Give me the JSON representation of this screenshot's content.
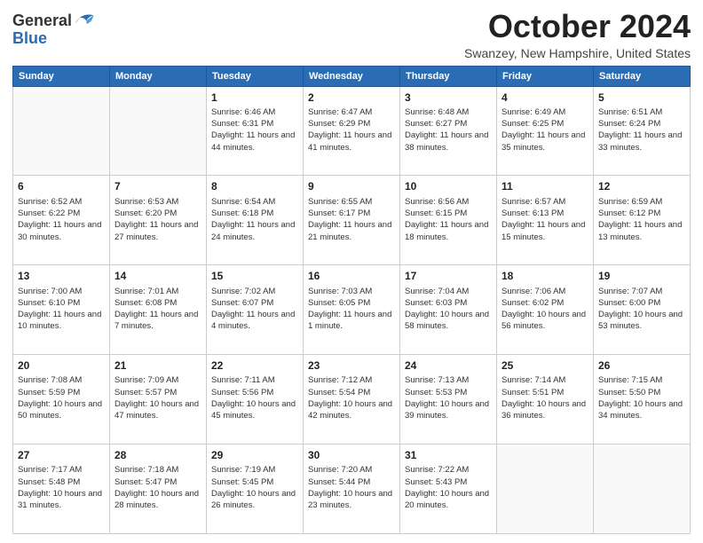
{
  "header": {
    "logo_general": "General",
    "logo_blue": "Blue",
    "month_title": "October 2024",
    "location": "Swanzey, New Hampshire, United States"
  },
  "days_of_week": [
    "Sunday",
    "Monday",
    "Tuesday",
    "Wednesday",
    "Thursday",
    "Friday",
    "Saturday"
  ],
  "weeks": [
    [
      {
        "day": "",
        "info": ""
      },
      {
        "day": "",
        "info": ""
      },
      {
        "day": "1",
        "info": "Sunrise: 6:46 AM\nSunset: 6:31 PM\nDaylight: 11 hours and 44 minutes."
      },
      {
        "day": "2",
        "info": "Sunrise: 6:47 AM\nSunset: 6:29 PM\nDaylight: 11 hours and 41 minutes."
      },
      {
        "day": "3",
        "info": "Sunrise: 6:48 AM\nSunset: 6:27 PM\nDaylight: 11 hours and 38 minutes."
      },
      {
        "day": "4",
        "info": "Sunrise: 6:49 AM\nSunset: 6:25 PM\nDaylight: 11 hours and 35 minutes."
      },
      {
        "day": "5",
        "info": "Sunrise: 6:51 AM\nSunset: 6:24 PM\nDaylight: 11 hours and 33 minutes."
      }
    ],
    [
      {
        "day": "6",
        "info": "Sunrise: 6:52 AM\nSunset: 6:22 PM\nDaylight: 11 hours and 30 minutes."
      },
      {
        "day": "7",
        "info": "Sunrise: 6:53 AM\nSunset: 6:20 PM\nDaylight: 11 hours and 27 minutes."
      },
      {
        "day": "8",
        "info": "Sunrise: 6:54 AM\nSunset: 6:18 PM\nDaylight: 11 hours and 24 minutes."
      },
      {
        "day": "9",
        "info": "Sunrise: 6:55 AM\nSunset: 6:17 PM\nDaylight: 11 hours and 21 minutes."
      },
      {
        "day": "10",
        "info": "Sunrise: 6:56 AM\nSunset: 6:15 PM\nDaylight: 11 hours and 18 minutes."
      },
      {
        "day": "11",
        "info": "Sunrise: 6:57 AM\nSunset: 6:13 PM\nDaylight: 11 hours and 15 minutes."
      },
      {
        "day": "12",
        "info": "Sunrise: 6:59 AM\nSunset: 6:12 PM\nDaylight: 11 hours and 13 minutes."
      }
    ],
    [
      {
        "day": "13",
        "info": "Sunrise: 7:00 AM\nSunset: 6:10 PM\nDaylight: 11 hours and 10 minutes."
      },
      {
        "day": "14",
        "info": "Sunrise: 7:01 AM\nSunset: 6:08 PM\nDaylight: 11 hours and 7 minutes."
      },
      {
        "day": "15",
        "info": "Sunrise: 7:02 AM\nSunset: 6:07 PM\nDaylight: 11 hours and 4 minutes."
      },
      {
        "day": "16",
        "info": "Sunrise: 7:03 AM\nSunset: 6:05 PM\nDaylight: 11 hours and 1 minute."
      },
      {
        "day": "17",
        "info": "Sunrise: 7:04 AM\nSunset: 6:03 PM\nDaylight: 10 hours and 58 minutes."
      },
      {
        "day": "18",
        "info": "Sunrise: 7:06 AM\nSunset: 6:02 PM\nDaylight: 10 hours and 56 minutes."
      },
      {
        "day": "19",
        "info": "Sunrise: 7:07 AM\nSunset: 6:00 PM\nDaylight: 10 hours and 53 minutes."
      }
    ],
    [
      {
        "day": "20",
        "info": "Sunrise: 7:08 AM\nSunset: 5:59 PM\nDaylight: 10 hours and 50 minutes."
      },
      {
        "day": "21",
        "info": "Sunrise: 7:09 AM\nSunset: 5:57 PM\nDaylight: 10 hours and 47 minutes."
      },
      {
        "day": "22",
        "info": "Sunrise: 7:11 AM\nSunset: 5:56 PM\nDaylight: 10 hours and 45 minutes."
      },
      {
        "day": "23",
        "info": "Sunrise: 7:12 AM\nSunset: 5:54 PM\nDaylight: 10 hours and 42 minutes."
      },
      {
        "day": "24",
        "info": "Sunrise: 7:13 AM\nSunset: 5:53 PM\nDaylight: 10 hours and 39 minutes."
      },
      {
        "day": "25",
        "info": "Sunrise: 7:14 AM\nSunset: 5:51 PM\nDaylight: 10 hours and 36 minutes."
      },
      {
        "day": "26",
        "info": "Sunrise: 7:15 AM\nSunset: 5:50 PM\nDaylight: 10 hours and 34 minutes."
      }
    ],
    [
      {
        "day": "27",
        "info": "Sunrise: 7:17 AM\nSunset: 5:48 PM\nDaylight: 10 hours and 31 minutes."
      },
      {
        "day": "28",
        "info": "Sunrise: 7:18 AM\nSunset: 5:47 PM\nDaylight: 10 hours and 28 minutes."
      },
      {
        "day": "29",
        "info": "Sunrise: 7:19 AM\nSunset: 5:45 PM\nDaylight: 10 hours and 26 minutes."
      },
      {
        "day": "30",
        "info": "Sunrise: 7:20 AM\nSunset: 5:44 PM\nDaylight: 10 hours and 23 minutes."
      },
      {
        "day": "31",
        "info": "Sunrise: 7:22 AM\nSunset: 5:43 PM\nDaylight: 10 hours and 20 minutes."
      },
      {
        "day": "",
        "info": ""
      },
      {
        "day": "",
        "info": ""
      }
    ]
  ]
}
